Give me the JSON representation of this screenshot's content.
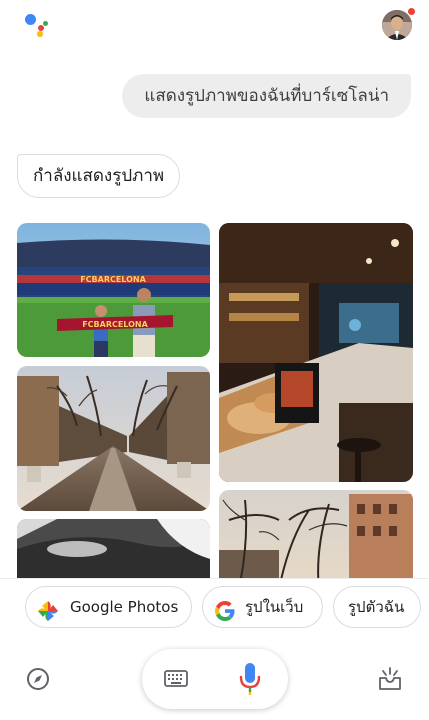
{
  "header": {
    "logo_icon": "google-assistant-dots-icon",
    "avatar_icon": "user-avatar",
    "badge_color": "#ea4335"
  },
  "conversation": {
    "user_query": "แสดงรูปภาพของฉันที่บาร์เซโลน่า",
    "assistant_reply": "กำลังแสดงรูปภาพ"
  },
  "photos": [
    {
      "id": "photo-stadium",
      "icon": "camp-nou-stadium-photo",
      "banner_text": "FCBARCELONA"
    },
    {
      "id": "photo-cafe",
      "icon": "cafe-interior-photo"
    },
    {
      "id": "photo-street",
      "icon": "la-rambla-street-photo"
    },
    {
      "id": "photo-blur",
      "icon": "blurred-photo"
    },
    {
      "id": "photo-trees",
      "icon": "tree-lined-avenue-photo"
    }
  ],
  "suggestions": [
    {
      "label": "Google Photos",
      "icon": "google-photos-pinwheel-icon"
    },
    {
      "label": "รูปในเว็บ",
      "icon": "google-g-icon"
    },
    {
      "label": "รูปตัวฉัน",
      "icon": ""
    }
  ],
  "bottom_bar": {
    "explore_icon": "compass-icon",
    "keyboard_icon": "keyboard-icon",
    "mic_icon": "mic-icon",
    "updates_icon": "inbox-updates-icon"
  },
  "colors": {
    "google_blue": "#4285f4",
    "google_red": "#ea4335",
    "google_yellow": "#fbbc05",
    "google_green": "#34a853"
  }
}
